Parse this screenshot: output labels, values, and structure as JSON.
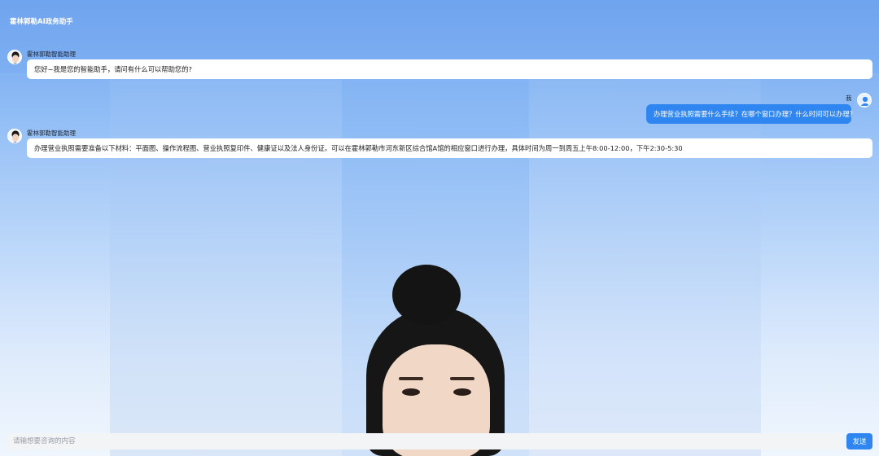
{
  "app": {
    "title": "霍林郭勒AI政务助手"
  },
  "colors": {
    "accent": "#2f86f0",
    "user_bubble": "#2f86f0",
    "bot_bubble": "#ffffff"
  },
  "messages": [
    {
      "role": "assistant",
      "sender": "霍林郭勒智能助理",
      "avatar_icon": "assistant-avatar-icon",
      "text": "您好~我是您的智能助手，请问有什么可以帮助您的?"
    },
    {
      "role": "user",
      "sender": "我",
      "avatar_icon": "user-avatar-icon",
      "text": "办理营业执照需要什么手续？在哪个窗口办理？什么时间可以办理？"
    },
    {
      "role": "assistant",
      "sender": "霍林郭勒智能助理",
      "avatar_icon": "assistant-avatar-icon",
      "text": "办理营业执照需要准备以下材料：平面图、操作流程图、营业执照复印件、健康证以及法人身份证。可以在霍林郭勒市河东新区综合馆A馆的相应窗口进行办理，具体时间为周一到周五上午8:00-12:00，下午2:30-5:30"
    }
  ],
  "composer": {
    "placeholder": "请输想要咨询的内容",
    "value": "",
    "send_label": "发送"
  }
}
